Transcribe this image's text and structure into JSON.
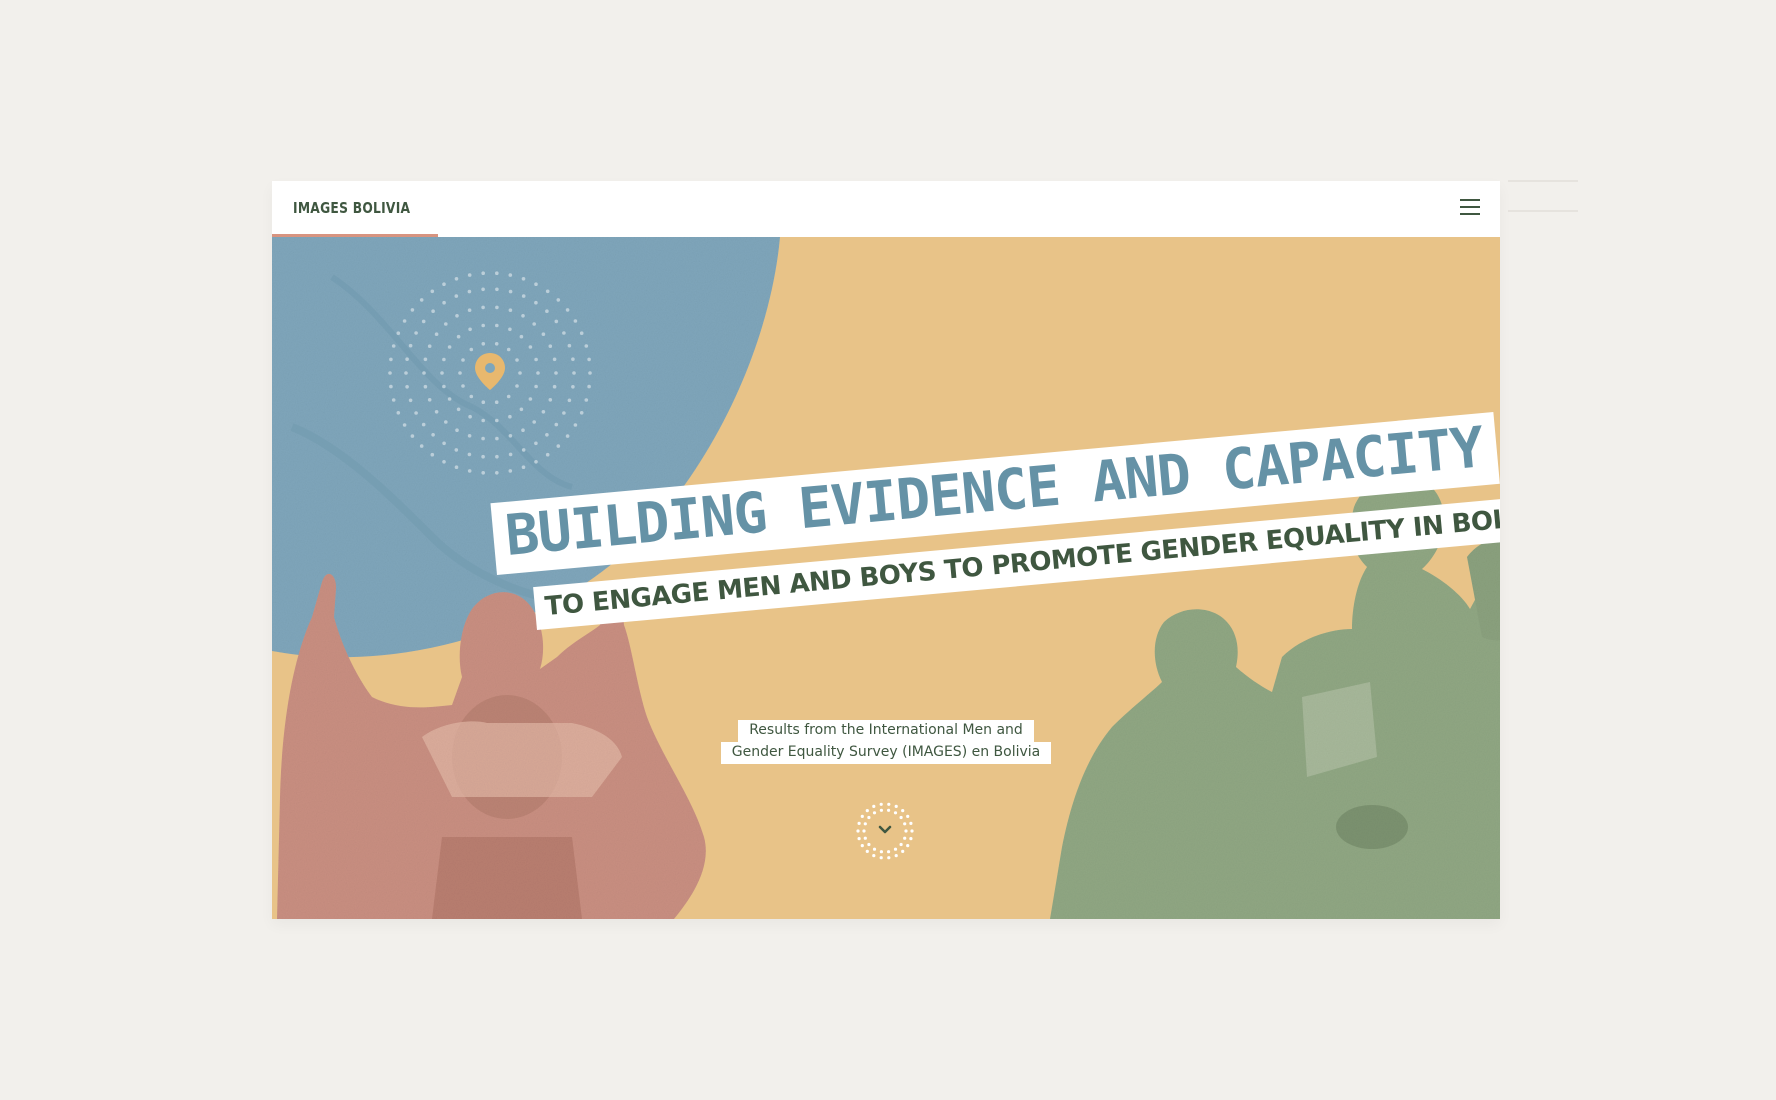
{
  "header": {
    "brand": "IMAGES BOLIVIA",
    "menu_icon": "hamburger-menu-icon"
  },
  "hero": {
    "title": "BUILDING EVIDENCE AND CAPACITY",
    "subtitle": "TO ENGAGE MEN AND BOYS TO PROMOTE GENDER EQUALITY IN BOLIVIA",
    "caption_line1": "Results from the International Men and",
    "caption_line2": "Gender Equality Survey (IMAGES) en Bolivia",
    "scroll_icon": "chevron-down-icon",
    "location_icon": "map-pin-icon"
  },
  "colors": {
    "background": "#f2f0ec",
    "hero_yellow": "#e8c388",
    "globe_blue": "#7fa6bb",
    "title_blue": "#6592a6",
    "text_green": "#3f5740",
    "accent_salmon": "#d79480",
    "photo_green": "#90a783",
    "photo_salmon": "#c98f81"
  }
}
